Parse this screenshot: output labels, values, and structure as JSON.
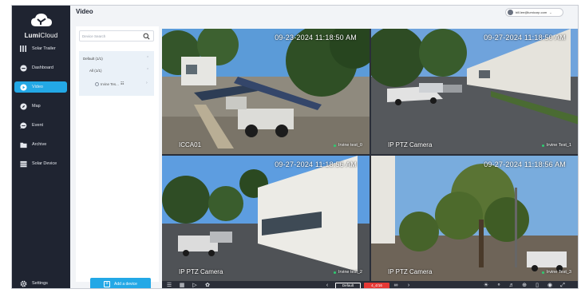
{
  "app": {
    "brand_bold": "Lumi",
    "brand_light": "Cloud"
  },
  "sidebar": {
    "items": [
      {
        "label": "Solar Trailer",
        "icon": "grid-icon"
      },
      {
        "label": "Dashboard",
        "icon": "dashboard-icon"
      },
      {
        "label": "Video",
        "icon": "play-icon",
        "active": true
      },
      {
        "label": "Map",
        "icon": "compass-icon"
      },
      {
        "label": "Event",
        "icon": "chat-icon"
      },
      {
        "label": "Archive",
        "icon": "folder-icon"
      },
      {
        "label": "Solar Device",
        "icon": "server-icon"
      }
    ],
    "settings_label": "Settings"
  },
  "header": {
    "title": "Video",
    "user_email": "bill.lee@lumicorp.com"
  },
  "device_panel": {
    "search_placeholder": "Device Search",
    "tree": {
      "group": "Default (1/1)",
      "subgroup": "All (1/1)",
      "device": "Irvine Tes..."
    },
    "add_device_label": "Add a device"
  },
  "tiles": [
    {
      "timestamp": "09-23-2024 11:18:50 AM",
      "name": "ICCA01",
      "tag": "Irvine test_0",
      "selected": true
    },
    {
      "timestamp": "09-27-2024 11:18:50 AM",
      "name": "IP PTZ Camera",
      "tag": "Irvine Test_1",
      "selected": false
    },
    {
      "timestamp": "09-27-2024 11:18:56 AM",
      "name": "IP PTZ Camera",
      "tag": "Irvine test_2",
      "selected": false
    },
    {
      "timestamp": "09-27-2024 11:18:56 AM",
      "name": "IP PTZ Camera",
      "tag": "Irvine Test_3",
      "selected": false
    }
  ],
  "toolbar": {
    "layout_select": "Default",
    "record_label": "4_4/16"
  },
  "colors": {
    "sidebar_bg": "#1f2431",
    "accent": "#23a8e6",
    "record_red": "#e53935",
    "online_green": "#2ecc71"
  }
}
